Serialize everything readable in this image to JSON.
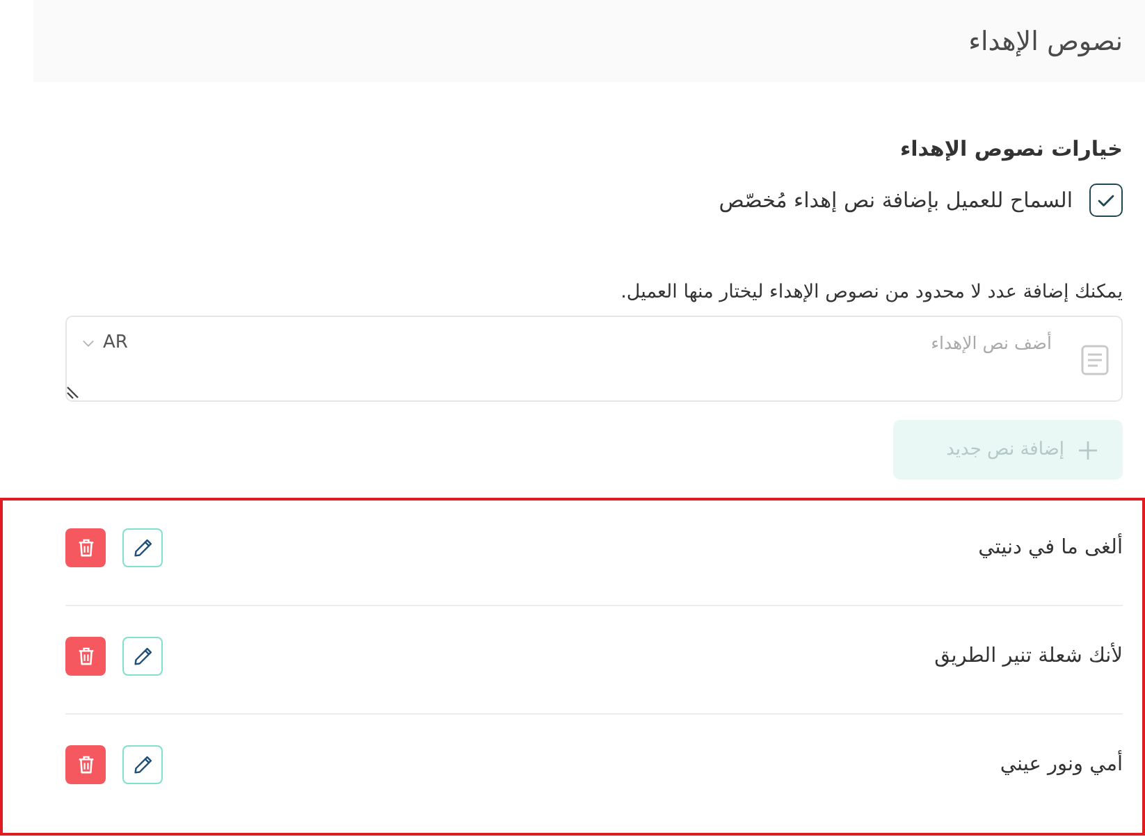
{
  "header": {
    "title": "نصوص الإهداء"
  },
  "options": {
    "heading": "خيارات نصوص الإهداء",
    "allow_custom": {
      "label": "السماح للعميل بإضافة نص إهداء مُخصّص",
      "checked": true
    }
  },
  "description": "يمكنك إضافة عدد لا محدود من نصوص الإهداء ليختار منها العميل.",
  "gift_text_field": {
    "placeholder": "أضف نص الإهداء",
    "language": "AR"
  },
  "add_button": {
    "label": "إضافة نص جديد",
    "disabled": true
  },
  "gift_texts": [
    "ألغى ما في دنيتي",
    "لأنك شعلة تنير الطريق",
    "أمي ونور عيني"
  ]
}
